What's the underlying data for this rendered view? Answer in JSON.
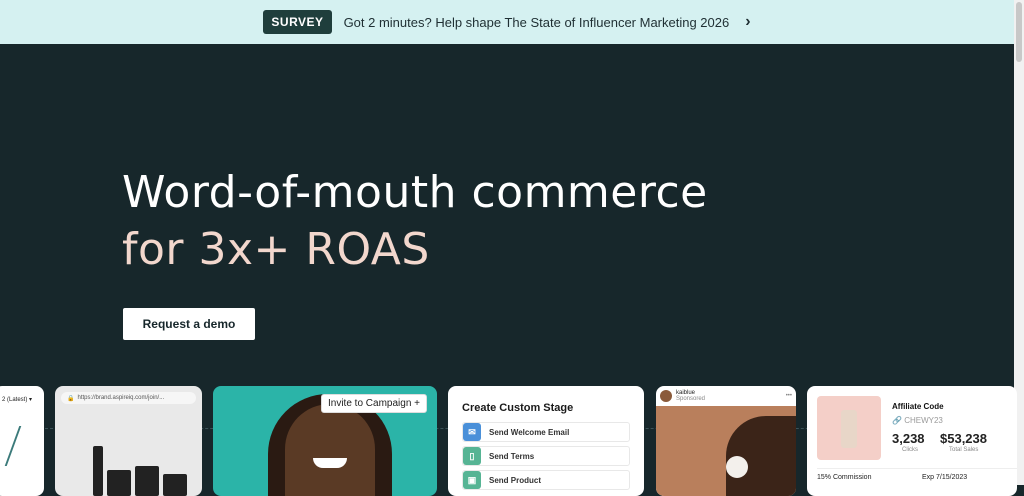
{
  "banner": {
    "badge": "SURVEY",
    "text": "Got 2 minutes? Help shape The State of Influencer Marketing 2026",
    "arrow_icon": "chevron-right-icon"
  },
  "hero": {
    "headline_line1": "Word-of-mouth commerce",
    "headline_line2": "for 3x+ ROAS",
    "cta_label": "Request a demo",
    "colors": {
      "background": "#17272b",
      "accent": "#f2d7cd",
      "banner": "#d5f1f1"
    }
  },
  "cards": {
    "version_select": "2 (Latest)",
    "browser_url": "https://brand.aspireiq.com/join/...",
    "invite_label": "Invite to Campaign +",
    "custom_stage": {
      "title": "Create Custom Stage",
      "items": [
        "Send Welcome Email",
        "Send Terms",
        "Send Product"
      ]
    },
    "social": {
      "handle": "kaiblue",
      "sponsored": "Sponsored"
    },
    "affiliate": {
      "title": "Affiliate Code",
      "code": "CHEWY23",
      "clicks_value": "3,238",
      "clicks_label": "Clicks",
      "sales_value": "$53,238",
      "sales_label": "Total Sales",
      "commission": "15% Commission",
      "expiry": "Exp 7/15/2023"
    }
  }
}
